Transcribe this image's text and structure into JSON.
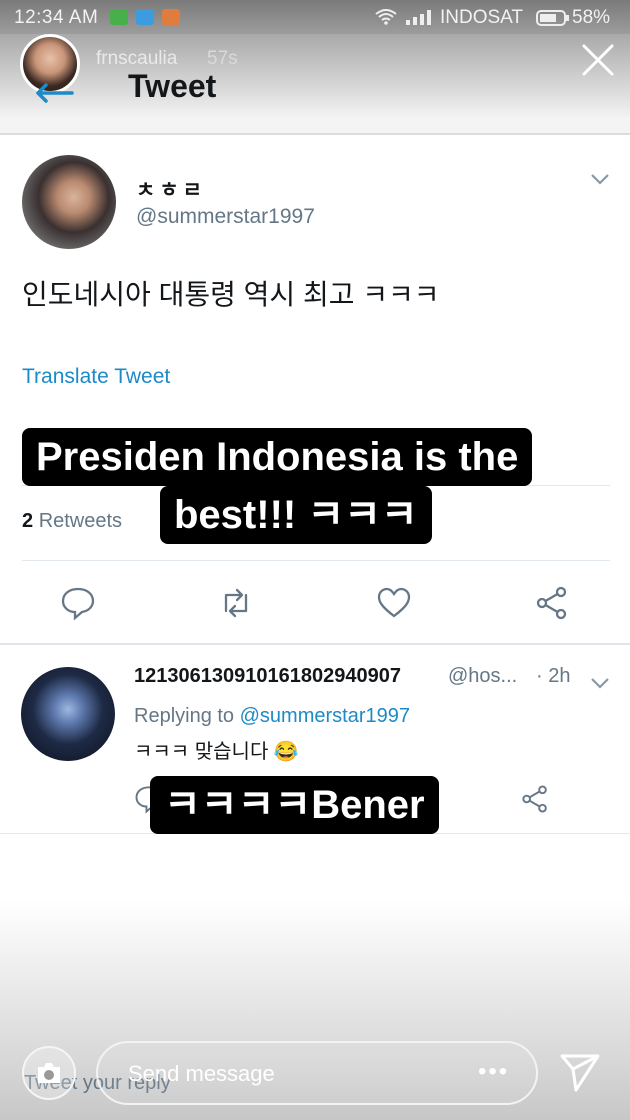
{
  "status_bar": {
    "time": "12:34 AM",
    "carrier": "INDOSAT",
    "battery": "58%"
  },
  "story": {
    "username": "frnscaulia",
    "time_ago": "57s",
    "send_placeholder": "Send message"
  },
  "header": {
    "title": "Tweet"
  },
  "tweet": {
    "author_name": "ㅊㅎㄹ",
    "author_handle": "@summerstar1997",
    "text": "인도네시아 대통령 역시 최고 ㅋㅋㅋ",
    "translate_label": "Translate Tweet",
    "retweet_count": "2",
    "retweet_label": "Retweets"
  },
  "reply": {
    "name": "1213061309101618029409​07",
    "handle": "@hos...",
    "time": "· 2h",
    "replying_label": "Replying to",
    "replying_handle": "@summerstar1997",
    "text": "ㅋㅋㅋ 맞습니다 😂"
  },
  "stickers": {
    "line1": "Presiden Indonesia is the",
    "line2": "best!!! ㅋㅋㅋ",
    "line3": "ㅋㅋㅋㅋBener"
  },
  "composer": {
    "placeholder": "Tweet your reply"
  },
  "icons": [
    "close-icon",
    "back-arrow-icon",
    "chevron-down-icon",
    "reply-icon",
    "retweet-icon",
    "like-icon",
    "share-icon",
    "camera-icon",
    "more-icon",
    "send-icon"
  ],
  "colors": {
    "accent": "#1d8ac8",
    "muted": "#657786",
    "text": "#14171a"
  }
}
